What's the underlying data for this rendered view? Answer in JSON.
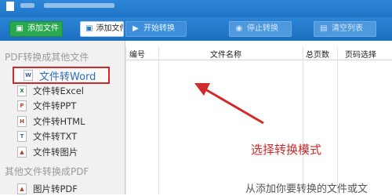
{
  "toolbar": {
    "add_file": "添加文件",
    "add_folder": "添加文件",
    "start": "开始转换",
    "stop": "停止转换",
    "clear": "清空列表"
  },
  "sidebar": {
    "section1": "PDF转换成其他文件",
    "items": [
      {
        "label": "文件转Word",
        "icon": "word-file-icon"
      },
      {
        "label": "文件转Excel",
        "icon": "excel-file-icon"
      },
      {
        "label": "文件转PPT",
        "icon": "ppt-file-icon"
      },
      {
        "label": "文件转HTML",
        "icon": "html-file-icon"
      },
      {
        "label": "文件转TXT",
        "icon": "txt-file-icon"
      },
      {
        "label": "文件转图片",
        "icon": "image-file-icon"
      }
    ],
    "section2": "其他文件转换成PDF",
    "items2": [
      {
        "label": "图片转PDF",
        "icon": "image-file-icon"
      }
    ]
  },
  "table": {
    "headers": [
      "编号",
      "文件名称",
      "总页数",
      "页码选择"
    ]
  },
  "annotation": "选择转换模式",
  "watermark": "从添加你要转换的文件或文",
  "colors": {
    "header_blue": "#2b84d5",
    "highlight_red": "#d02828",
    "add_green": "#2aa84f"
  }
}
